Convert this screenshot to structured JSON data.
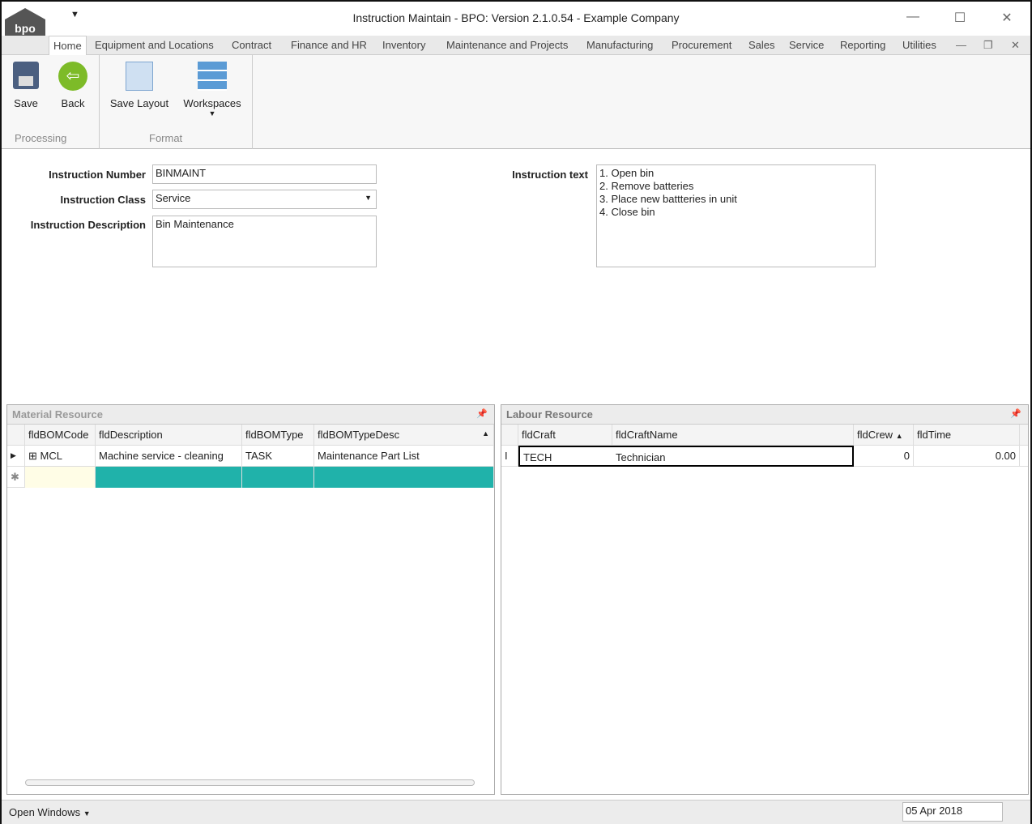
{
  "window": {
    "title": "Instruction Maintain - BPO: Version 2.1.0.54 - Example Company",
    "logo": "bpo"
  },
  "tabs": [
    "Home",
    "Equipment and Locations",
    "Contract",
    "Finance and HR",
    "Inventory",
    "Maintenance and Projects",
    "Manufacturing",
    "Procurement",
    "Sales",
    "Service",
    "Reporting",
    "Utilities"
  ],
  "ribbon": {
    "save": "Save",
    "back": "Back",
    "save_layout": "Save Layout",
    "workspaces": "Workspaces",
    "group_processing": "Processing",
    "group_format": "Format"
  },
  "form": {
    "number_label": "Instruction Number",
    "number": "BINMAINT",
    "class_label": "Instruction Class",
    "class": "Service",
    "desc_label": "Instruction Description",
    "desc": "Bin Maintenance",
    "text_label": "Instruction text",
    "text_lines": [
      "1. Open bin",
      "2. Remove batteries",
      "3. Place new battteries in unit",
      "4. Close bin"
    ]
  },
  "material": {
    "title": "Material Resource",
    "columns": [
      "fldBOMCode",
      "fldDescription",
      "fldBOMType",
      "fldBOMTypeDesc"
    ],
    "rows": [
      [
        "MCL",
        "Machine service - cleaning",
        "TASK",
        "Maintenance Part List"
      ]
    ]
  },
  "labour": {
    "title": "Labour Resource",
    "columns": [
      "fldCraft",
      "fldCraftName",
      "fldCrew",
      "fldTime"
    ],
    "rows": [
      [
        "TECH",
        "Technician",
        "0",
        "0.00"
      ]
    ]
  },
  "status": {
    "open_windows": "Open Windows",
    "date": "05 Apr 2018"
  }
}
